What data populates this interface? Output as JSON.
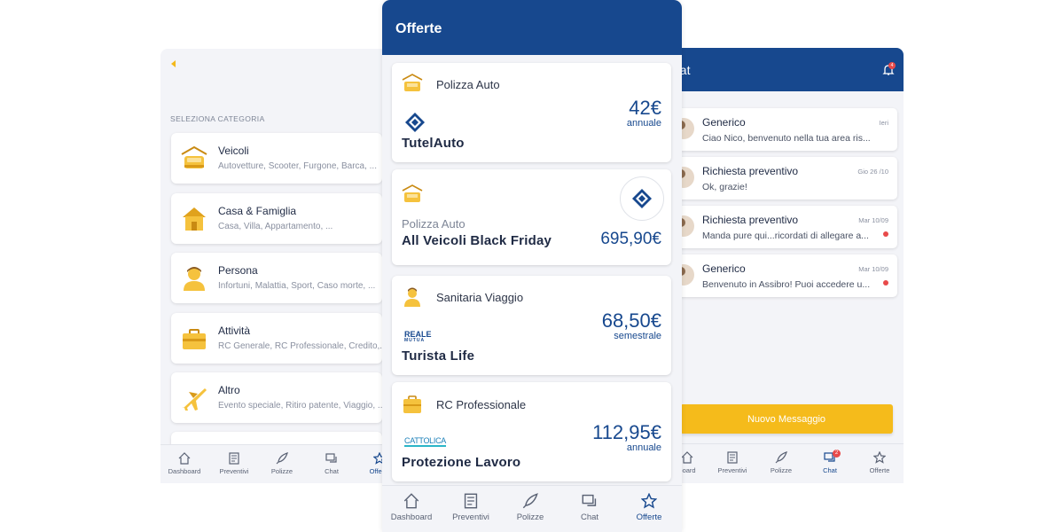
{
  "left": {
    "section_header": "SELEZIONA CATEGORIA",
    "categories": [
      {
        "title": "Veicoli",
        "subtitle": "Autovetture, Scooter, Furgone, Barca, ...",
        "icon": "car-garage-icon"
      },
      {
        "title": "Casa & Famiglia",
        "subtitle": "Casa, Villa, Appartamento, ...",
        "icon": "house-icon"
      },
      {
        "title": "Persona",
        "subtitle": "Infortuni, Malattia, Sport, Caso morte, ...",
        "icon": "person-icon"
      },
      {
        "title": "Attività",
        "subtitle": "RC Generale, RC Professionale, Credito,...",
        "icon": "briefcase-icon"
      },
      {
        "title": "Altro",
        "subtitle": "Evento speciale, Ritiro patente, Viaggio, ...",
        "icon": "airplane-icon"
      }
    ],
    "nav": [
      "Dashboard",
      "Preventivi",
      "Polizze",
      "Chat",
      "Offerte"
    ]
  },
  "center": {
    "title": "Offerte",
    "offers": [
      {
        "category": "Polizza Auto",
        "product": "TutelAuto",
        "price": "42€",
        "period": "annuale"
      },
      {
        "category": "Polizza Auto",
        "product": "All Veicoli Black Friday",
        "price": "695,90€",
        "period": ""
      },
      {
        "category": "Sanitaria Viaggio",
        "product": "Turista Life",
        "price": "68,50€",
        "period": "semestrale",
        "logo_line1": "REALE",
        "logo_line2": "MUTUA"
      },
      {
        "category": "RC Professionale",
        "product": "Protezione Lavoro",
        "price": "112,95€",
        "period": "annuale",
        "logo": "CATTOLICA"
      }
    ],
    "nav": [
      "Dashboard",
      "Preventivi",
      "Polizze",
      "Chat",
      "Offerte"
    ]
  },
  "right": {
    "title": "hat",
    "bell_badge": "4",
    "messages": [
      {
        "from": "Generico",
        "text": "Ciao Nico, benvenuto nella tua area ris...",
        "date": "Ieri",
        "unread": false
      },
      {
        "from": "Richiesta preventivo",
        "text": "Ok, grazie!",
        "date": "Gio 26 /10",
        "unread": false
      },
      {
        "from": "Richiesta preventivo",
        "text": "Manda pure qui...ricordati di allegare a...",
        "date": "Mar 10/09",
        "unread": true
      },
      {
        "from": "Generico",
        "text": "Benvenuto in Assibro! Puoi accedere u...",
        "date": "Mar 10/09",
        "unread": true
      }
    ],
    "new_message_label": "Nuovo Messaggio",
    "chat_badge": "2",
    "nav": [
      "board",
      "Preventivi",
      "Polizze",
      "Chat",
      "Offerte"
    ]
  },
  "colors": {
    "brand_blue": "#17488e",
    "accent_yellow": "#f5bb1b",
    "alert_red": "#e84a4a"
  }
}
